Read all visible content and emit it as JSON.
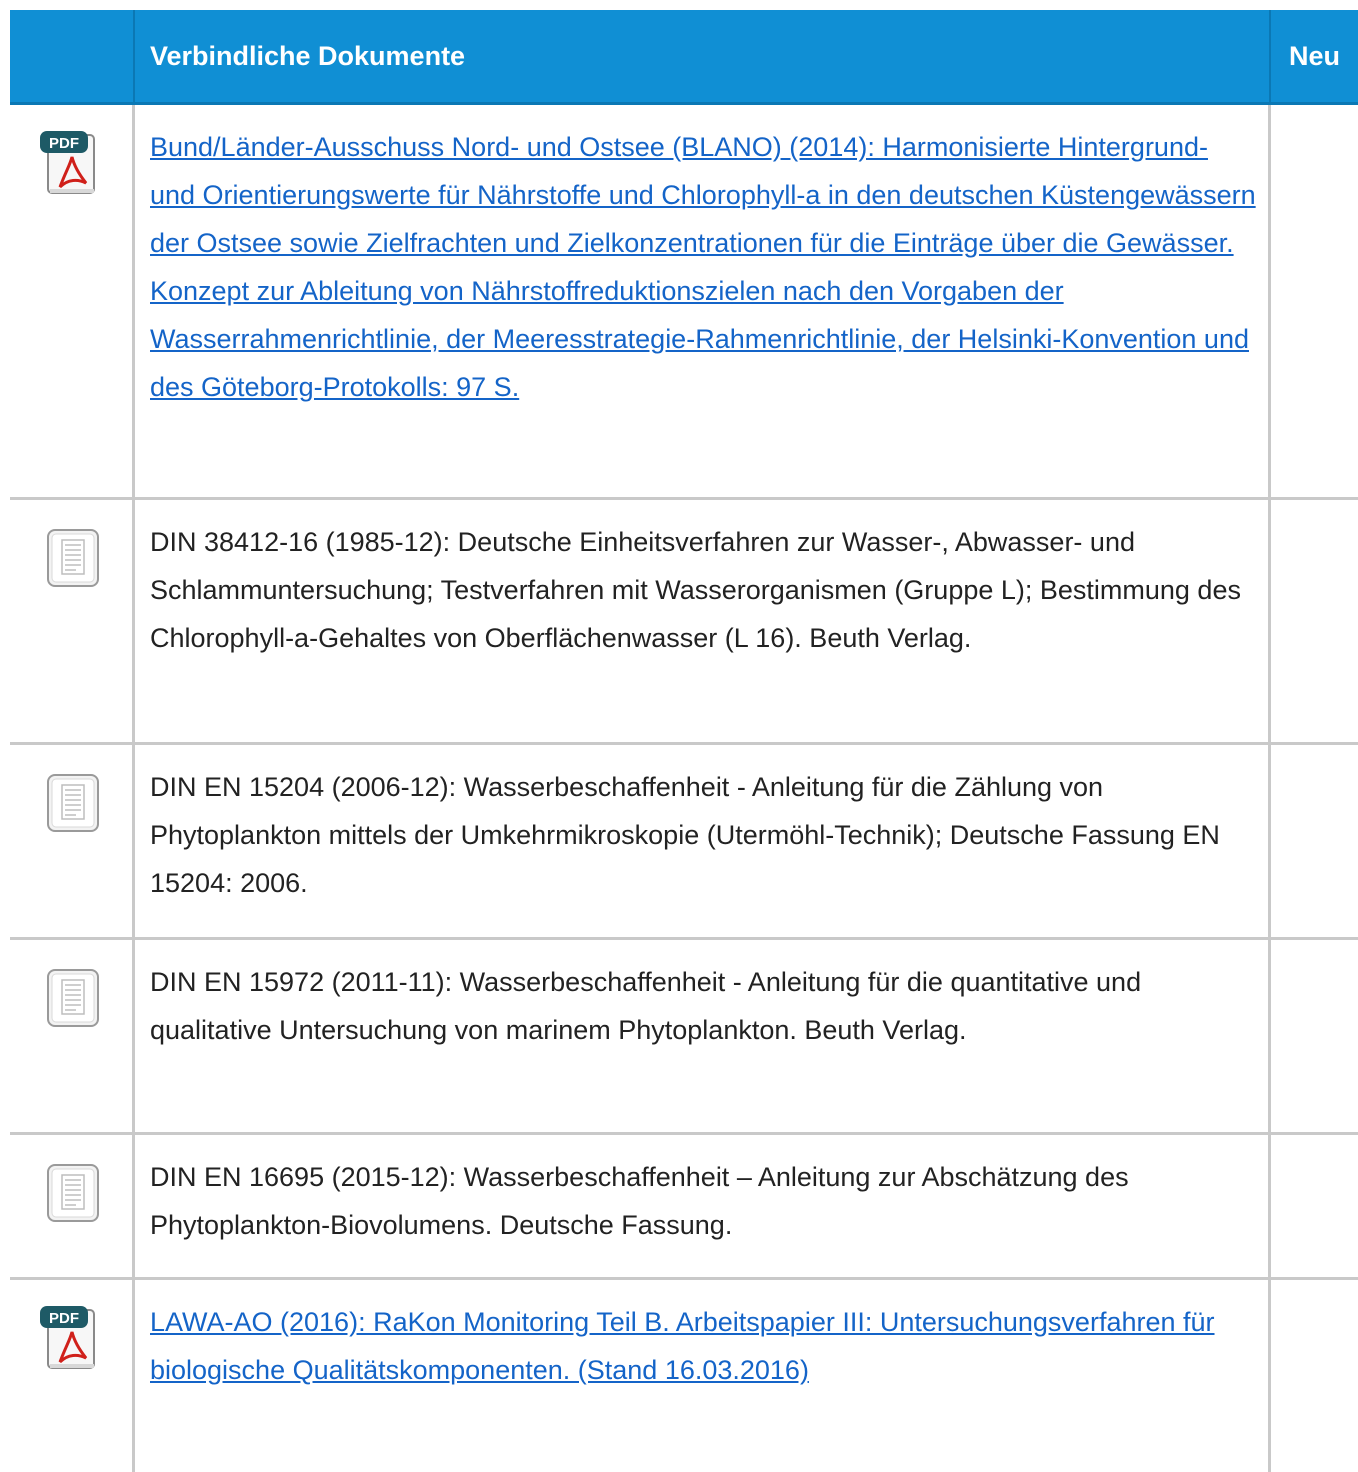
{
  "table": {
    "header": {
      "documents_label": "Verbindliche Dokumente",
      "new_label": "Neu"
    },
    "rows": [
      {
        "type": "pdf",
        "icon": "pdf-file-icon",
        "icon_badge": "PDF",
        "is_link": true,
        "text": "Bund/Länder-Ausschuss Nord- und Ostsee (BLANO) (2014): Harmonisierte Hintergrund- und Orientierungswerte für Nährstoffe und Chlorophyll-a in den deutschen Küstengewässern der Ostsee sowie Zielfrachten und Zielkonzentrationen für die Einträge über die Gewässer. Konzept zur Ableitung von Nährstoffreduktionszielen nach den Vorgaben der Wasserrahmenrichtlinie, der Meeresstrategie-Rahmenrichtlinie, der Helsinki-Konvention und des Göteborg-Protokolls: 97 S."
      },
      {
        "type": "document",
        "icon": "document-icon",
        "is_link": false,
        "text": "DIN 38412-16 (1985-12): Deutsche Einheitsverfahren zur Wasser-, Abwasser- und Schlammuntersuchung; Testverfahren mit Wasserorganismen (Gruppe L); Bestimmung des Chlorophyll-a-Gehaltes von Oberflächenwasser (L 16). Beuth Verlag."
      },
      {
        "type": "document",
        "icon": "document-icon",
        "is_link": false,
        "text": "DIN EN 15204 (2006-12): Wasserbeschaffenheit - Anleitung für die Zählung von Phytoplankton mittels der Umkehrmikroskopie (Utermöhl-Technik); Deutsche Fassung EN 15204: 2006."
      },
      {
        "type": "document",
        "icon": "document-icon",
        "is_link": false,
        "text": "DIN EN 15972 (2011-11): Wasserbeschaffenheit - Anleitung für die quantitative und qualitative Untersuchung von marinem Phytoplankton. Beuth Verlag."
      },
      {
        "type": "document",
        "icon": "document-icon",
        "is_link": false,
        "text": "DIN EN 16695 (2015-12): Wasserbeschaffenheit – Anleitung zur Abschätzung des Phytoplankton-Biovolumens. Deutsche Fassung."
      },
      {
        "type": "pdf",
        "icon": "pdf-file-icon",
        "icon_badge": "PDF",
        "is_link": true,
        "text": "LAWA-AO (2016): RaKon Monitoring Teil B. Arbeitspapier III: Untersuchungsverfahren für biologische Qualitätskomponenten. (Stand 16.03.2016)"
      }
    ]
  },
  "colors": {
    "header_bg": "#108fd4",
    "link": "#1464c8",
    "grid": "#c9c9c9",
    "pdf_badge": "#1e5a66",
    "pdf_red": "#d0201a"
  }
}
